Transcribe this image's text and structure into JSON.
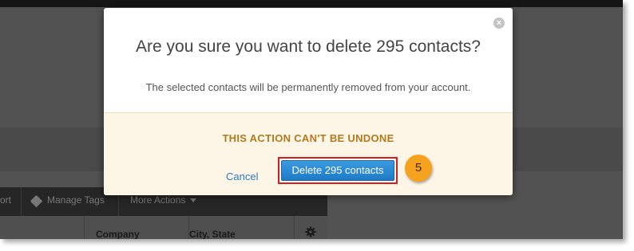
{
  "background": {
    "toolbar": {
      "export_partial": "ort",
      "manage_tags": "Manage Tags",
      "more_actions": "More Actions"
    },
    "table": {
      "columns": [
        "Company",
        "City, State"
      ]
    }
  },
  "modal": {
    "title": "Are you sure you want to delete 295 contacts?",
    "message": "The selected contacts will be permanently removed from your account.",
    "warning": "THIS ACTION CAN'T BE UNDONE",
    "cancel_label": "Cancel",
    "delete_label": "Delete 295 contacts",
    "close_symbol": "×"
  },
  "annotation": {
    "step": "5"
  },
  "colors": {
    "warning_text": "#b5781f",
    "primary_button": "#1f7ac6",
    "highlight_border": "#d21f1f",
    "step_badge": "#f6a21e",
    "footer_bg": "#fdf5e6"
  }
}
